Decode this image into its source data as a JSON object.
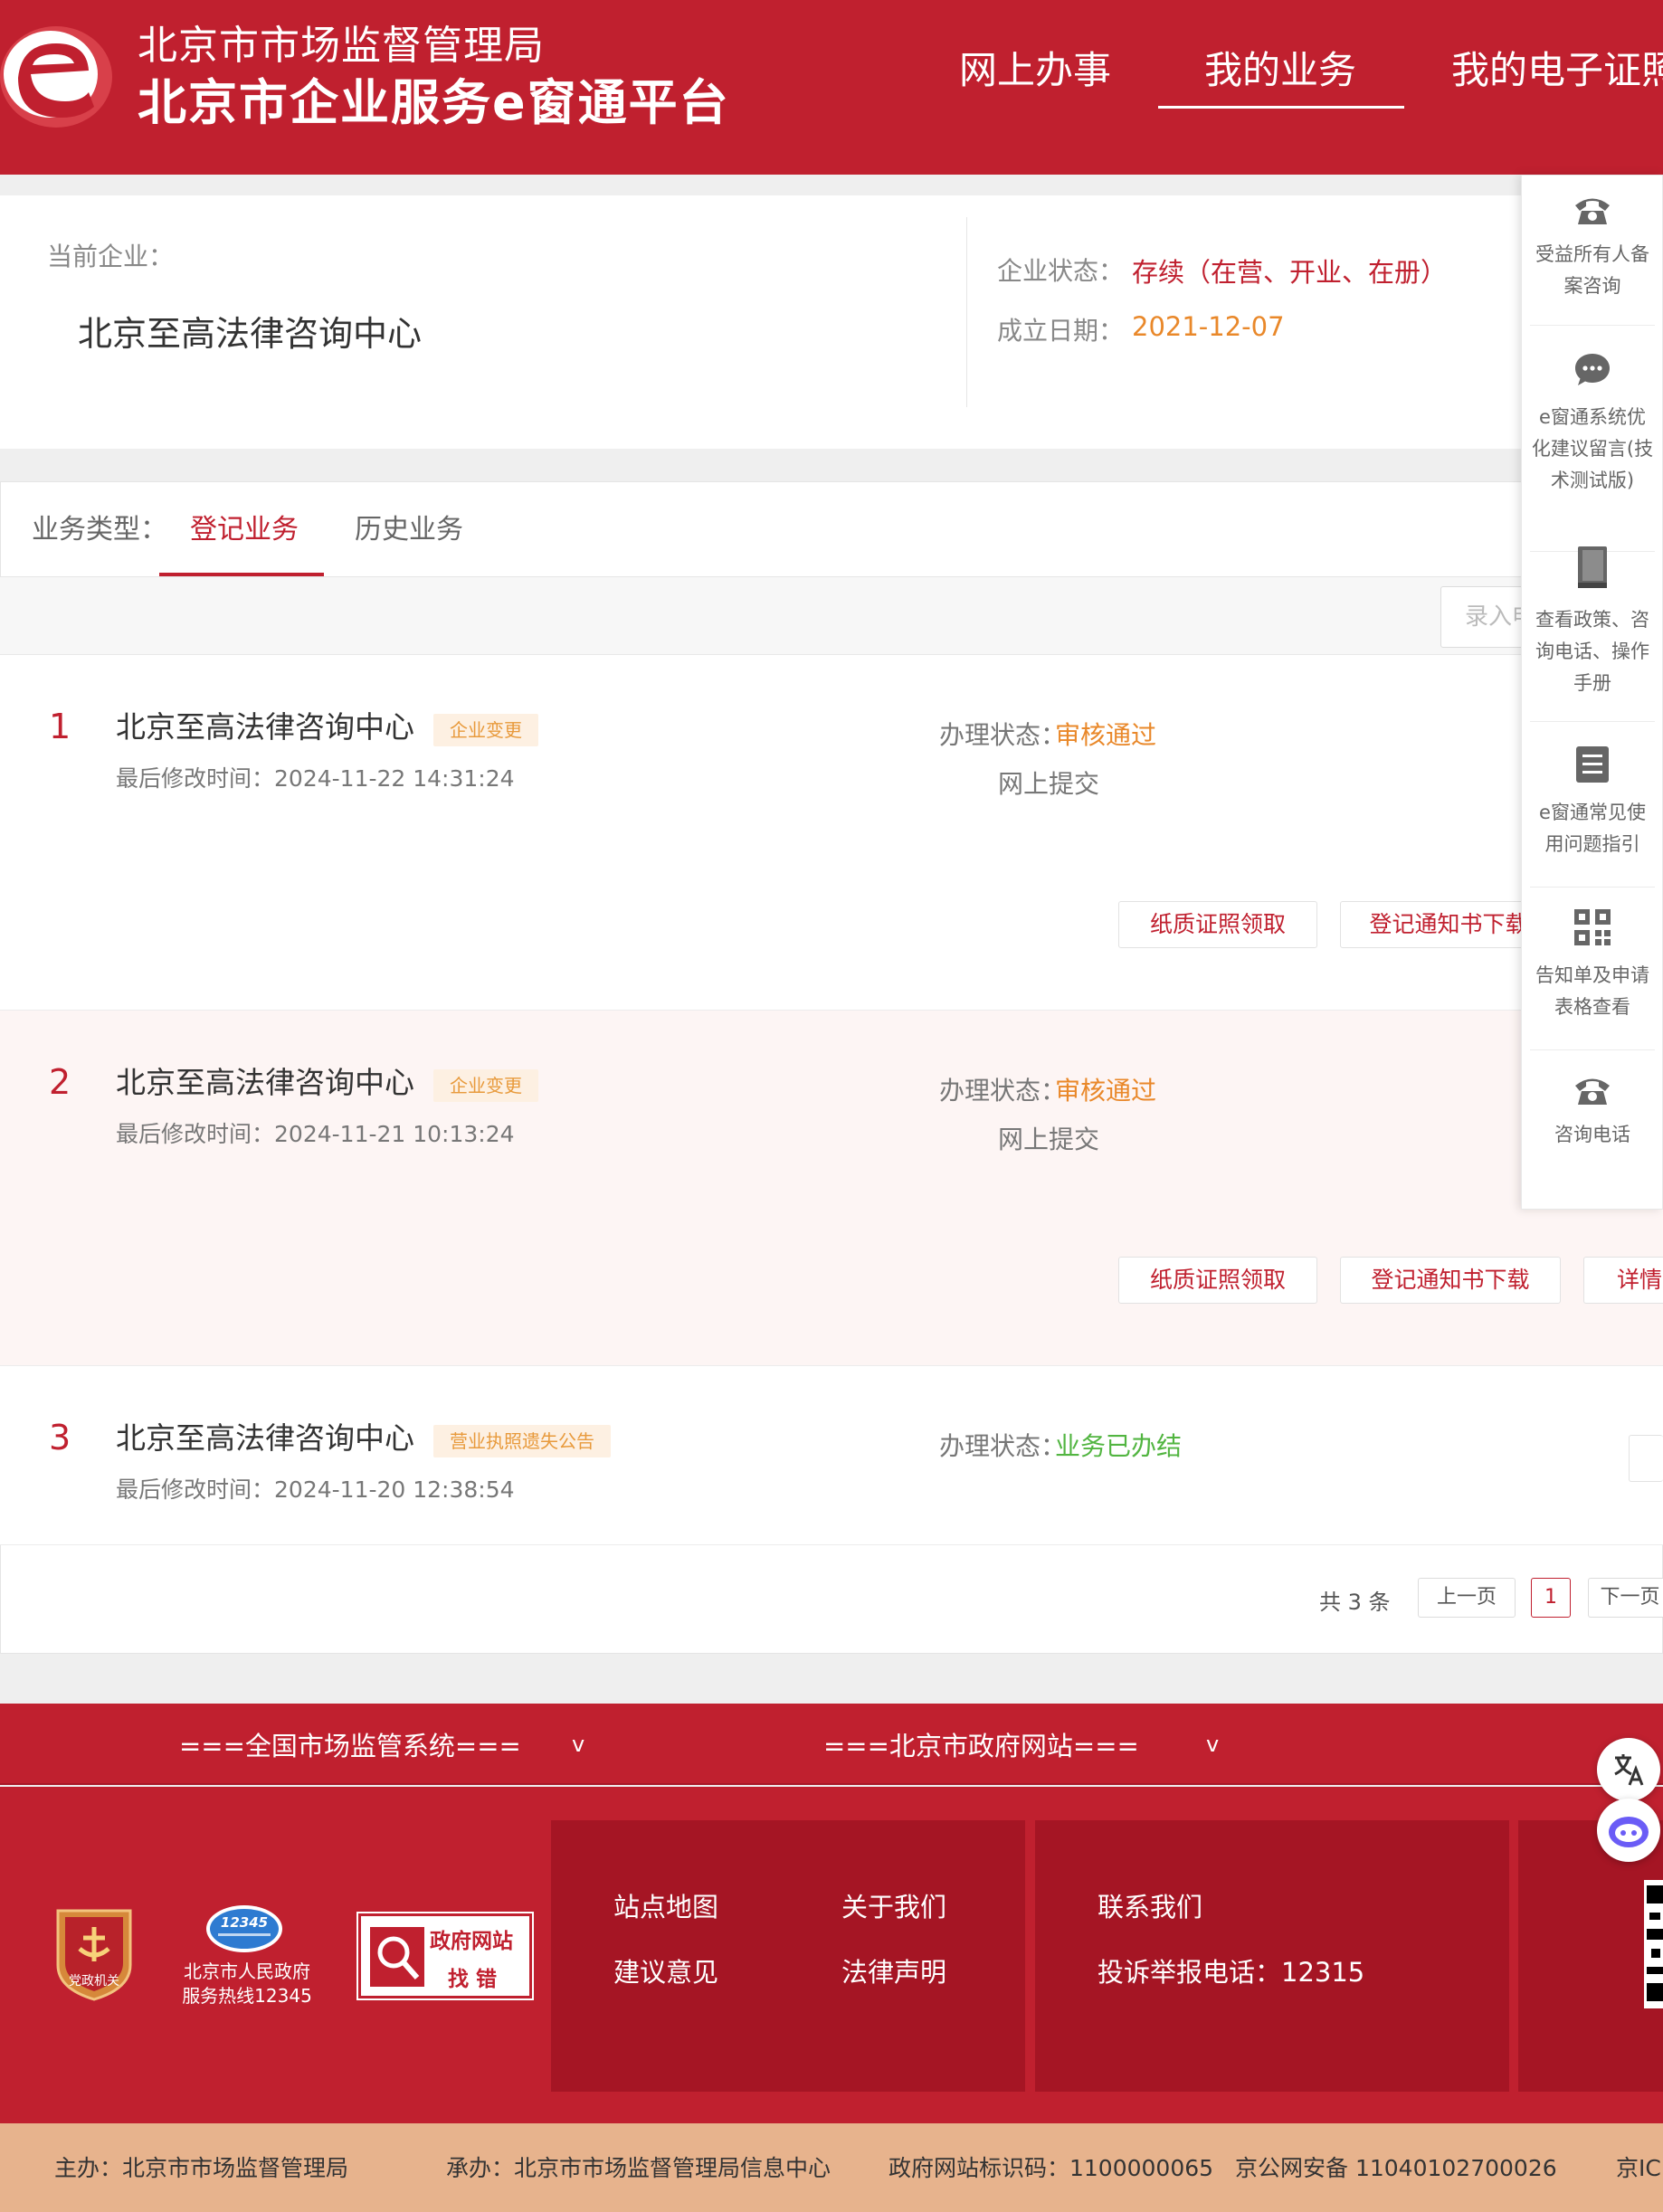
{
  "header": {
    "brand_top": "北京市市场监督管理局",
    "brand_main": "北京市企业服务e窗通平台",
    "nav": [
      "网上办事",
      "我的业务",
      "我的电子证照"
    ],
    "active_nav_index": 1
  },
  "company": {
    "current_label": "当前企业：",
    "name": "北京至高法律咨询中心",
    "status_label": "企业状态：",
    "status_value": "存续（在营、开业、在册）",
    "founded_label": "成立日期：",
    "founded_value": "2021-12-07"
  },
  "business": {
    "type_label": "业务类型：",
    "tabs": [
      "登记业务",
      "历史业务"
    ],
    "active_tab_index": 0,
    "search_placeholder": "录入申",
    "status_label": "办理状态：",
    "rows": [
      {
        "num": "1",
        "name": "北京至高法律咨询中心",
        "tag": "企业变更",
        "time_label": "最后修改时间：",
        "time": "2024-11-22 14:31:24",
        "status": "审核通过",
        "submit": "网上提交",
        "buttons": [
          "纸质证照领取",
          "登记通知书下载"
        ]
      },
      {
        "num": "2",
        "name": "北京至高法律咨询中心",
        "tag": "企业变更",
        "time_label": "最后修改时间：",
        "time": "2024-11-21 10:13:24",
        "status": "审核通过",
        "submit": "网上提交",
        "buttons": [
          "纸质证照领取",
          "登记通知书下载",
          "详情"
        ]
      },
      {
        "num": "3",
        "name": "北京至高法律咨询中心",
        "tag": "营业执照遗失公告",
        "time_label": "最后修改时间：",
        "time": "2024-11-20 12:38:54",
        "status": "业务已办结",
        "submit": "",
        "buttons": []
      }
    ],
    "pagination": {
      "total": "共 3 条",
      "prev": "上一页",
      "current": "1",
      "next": "下一页"
    }
  },
  "float_sidebar": [
    {
      "icon": "phone-icon",
      "text": "受益所有人备案咨询"
    },
    {
      "icon": "chat-icon",
      "text": "e窗通系统优化建议留言(技术测试版)"
    },
    {
      "icon": "book-icon",
      "text": "查看政策、咨询电话、操作手册"
    },
    {
      "icon": "document-icon",
      "text": "e窗通常见使用问题指引"
    },
    {
      "icon": "qrcode-icon",
      "text": "告知单及申请表格查看"
    },
    {
      "icon": "phone-icon",
      "text": "咨询电话"
    }
  ],
  "footer": {
    "dropdowns": [
      "===全国市场监管系统===",
      "===北京市政府网站==="
    ],
    "badges": {
      "party_label": "党政机关",
      "hotline_number": "12345",
      "hotline_line1": "北京市人民政府",
      "hotline_line2": "服务热线12345",
      "gov_title": "政府网站",
      "gov_sub": "找 错"
    },
    "links_col1": [
      "站点地图",
      "建议意见"
    ],
    "links_col2": [
      "关于我们",
      "法律声明"
    ],
    "contact_title": "联系我们",
    "contact_phone": "投诉举报电话：12315",
    "bottom": [
      "主办：北京市市场监督管理局",
      "承办：北京市市场监督管理局信息中心",
      "政府网站标识码：1100000065",
      "京公网安备 11040102700026",
      "京ICP"
    ]
  },
  "colors": {
    "brand_red": "#c0202f",
    "orange": "#e9882a",
    "green": "#52b541",
    "row_highlight": "#fdf5f4"
  }
}
